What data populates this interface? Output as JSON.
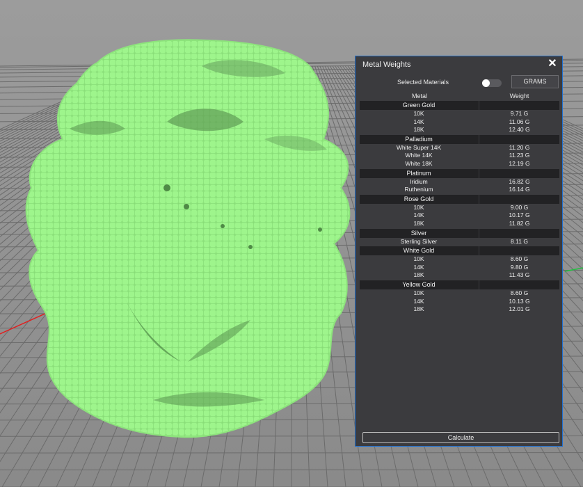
{
  "panel": {
    "title": "Metal Weights",
    "close_icon": "close-icon",
    "selected_materials_label": "Selected Materials",
    "selected_materials_toggle": false,
    "units_button": "GRAMS",
    "columns": {
      "metal": "Metal",
      "weight": "Weight"
    },
    "groups": [
      {
        "name": "Green Gold",
        "rows": [
          {
            "metal": "10K",
            "weight": "9.71 G"
          },
          {
            "metal": "14K",
            "weight": "11.06 G"
          },
          {
            "metal": "18K",
            "weight": "12.40 G"
          }
        ]
      },
      {
        "name": "Palladium",
        "rows": [
          {
            "metal": "White Super 14K",
            "weight": "11.20 G"
          },
          {
            "metal": "White 14K",
            "weight": "11.23 G"
          },
          {
            "metal": "White 18K",
            "weight": "12.19 G"
          }
        ]
      },
      {
        "name": "Platinum",
        "rows": [
          {
            "metal": "Iridium",
            "weight": "16.82 G"
          },
          {
            "metal": "Ruthenium",
            "weight": "16.14 G"
          }
        ]
      },
      {
        "name": "Rose Gold",
        "rows": [
          {
            "metal": "10K",
            "weight": "9.00 G"
          },
          {
            "metal": "14K",
            "weight": "10.17 G"
          },
          {
            "metal": "18K",
            "weight": "11.82 G"
          }
        ]
      },
      {
        "name": "Silver",
        "rows": [
          {
            "metal": "Sterling Silver",
            "weight": "8.11 G"
          }
        ]
      },
      {
        "name": "White Gold",
        "rows": [
          {
            "metal": "10K",
            "weight": "8.60 G"
          },
          {
            "metal": "14K",
            "weight": "9.80 G"
          },
          {
            "metal": "18K",
            "weight": "11.43 G"
          }
        ]
      },
      {
        "name": "Yellow Gold",
        "rows": [
          {
            "metal": "10K",
            "weight": "8.60 G"
          },
          {
            "metal": "14K",
            "weight": "10.13 G"
          },
          {
            "metal": "18K",
            "weight": "12.01 G"
          }
        ]
      }
    ],
    "calculate_button": "Calculate"
  },
  "viewport": {
    "model_color": "#9ef58c",
    "model_shadow": "#6fbf62",
    "grid_color": "#6e6e6e",
    "background": "#8d8d8d",
    "x_axis_color": "#e02020",
    "y_axis_color": "#20c040"
  }
}
